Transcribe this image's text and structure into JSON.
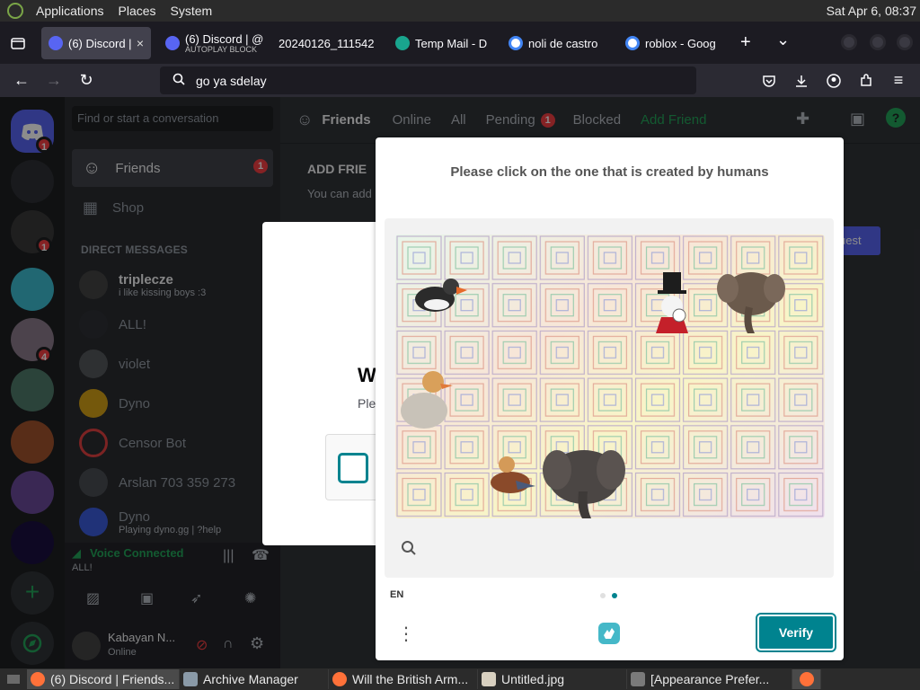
{
  "top_panel": {
    "menus": [
      "Applications",
      "Places",
      "System"
    ],
    "clock": "Sat Apr  6, 08:37"
  },
  "tabs": [
    {
      "title": "(6) Discord | ",
      "active": true,
      "close": "×"
    },
    {
      "title": "(6) Discord | @",
      "subtitle": "AUTOPLAY BLOCK"
    },
    {
      "title": "20240126_111542"
    },
    {
      "title": "Temp Mail - D"
    },
    {
      "title": "noli de castro"
    },
    {
      "title": "roblox - Goog"
    }
  ],
  "tabbar": {
    "new_tab": "+",
    "list_tabs": "⌄"
  },
  "urlbar": {
    "value": "go ya sdelay"
  },
  "discord": {
    "dm_search_placeholder": "Find or start a conversation",
    "nav": [
      {
        "label": "Friends",
        "badge": "1"
      },
      {
        "label": "Shop"
      }
    ],
    "dm_header": "DIRECT MESSAGES",
    "dms": [
      {
        "name": "triplecze",
        "sub": "i like kissing boys :3"
      },
      {
        "name": "ALL!"
      },
      {
        "name": "violet"
      },
      {
        "name": "Dyno"
      },
      {
        "name": "Censor Bot"
      },
      {
        "name": "Arslan 703 359 273"
      },
      {
        "name": "Dyno",
        "sub": "Playing dyno.gg | ?help"
      }
    ],
    "voice": {
      "status": "Voice Connected",
      "channel": "ALL!"
    },
    "user": {
      "name": "Kabayan N...",
      "status": "Online"
    },
    "friends_header": {
      "title": "Friends",
      "tabs": [
        "Online",
        "All",
        "Pending",
        "Blocked"
      ],
      "pending_badge": "1",
      "add_friend": "Add Friend"
    },
    "add_friend_panel": {
      "title": "ADD FRIE",
      "desc": "You can add",
      "btn": "uest"
    },
    "guild_badges": [
      "1",
      "1",
      "4"
    ]
  },
  "bg_modal": {
    "title": "W",
    "desc": "Ple"
  },
  "captcha": {
    "prompt": "Please click on the one that is created by humans",
    "language": "EN",
    "verify_label": "Verify",
    "accent": "#00838f"
  },
  "taskbar": [
    {
      "title": "(6) Discord | Friends..."
    },
    {
      "title": "Archive Manager"
    },
    {
      "title": "Will the British Arm..."
    },
    {
      "title": "Untitled.jpg"
    },
    {
      "title": "[Appearance Prefer..."
    }
  ]
}
